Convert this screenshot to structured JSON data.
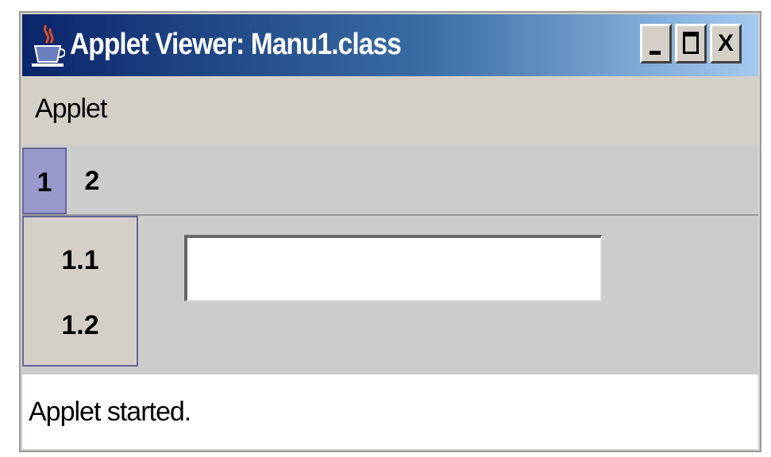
{
  "window": {
    "title": "Applet Viewer: Manu1.class",
    "icon": "java-coffee-cup-icon",
    "buttons": {
      "minimize": "minimize-icon",
      "maximize": "maximize-icon",
      "close": "X"
    }
  },
  "menubar": {
    "items": [
      {
        "label": "Applet"
      }
    ]
  },
  "applet_menu": {
    "tabs": [
      {
        "label": "1",
        "selected": true
      },
      {
        "label": "2",
        "selected": false
      }
    ],
    "popup_items": [
      {
        "label": "1.1"
      },
      {
        "label": "1.2"
      }
    ]
  },
  "text_field": {
    "value": ""
  },
  "status": {
    "text": "Applet started."
  },
  "colors": {
    "title_gradient_start": "#0a246a",
    "title_gradient_end": "#a6caf0",
    "selected_menu": "#9999cc",
    "window_bg": "#d4d0c8"
  }
}
